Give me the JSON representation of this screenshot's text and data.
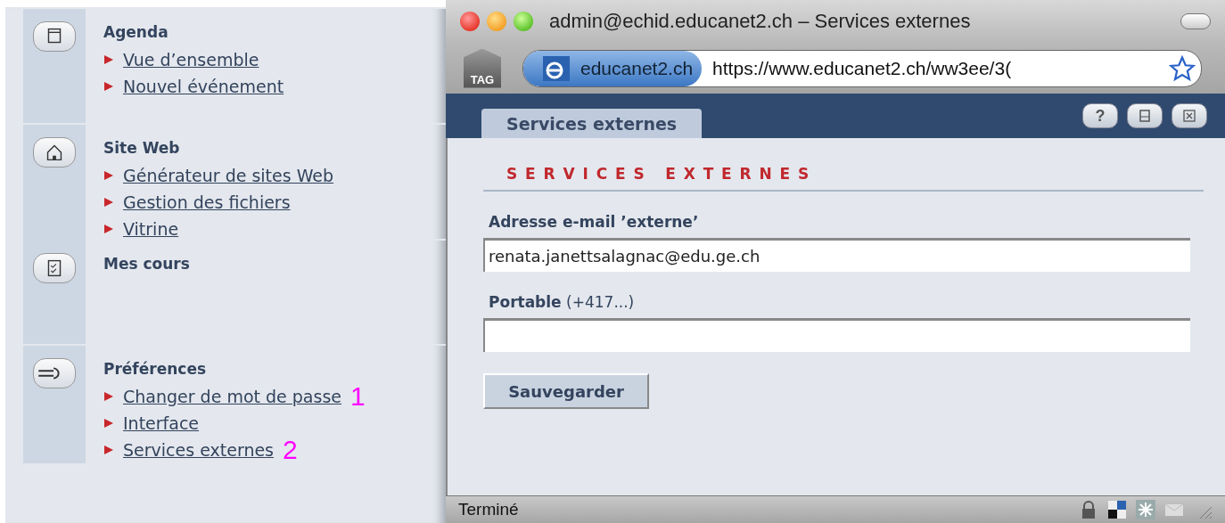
{
  "sidebar": {
    "sections": [
      {
        "kind": "agenda",
        "title": "Agenda",
        "items": [
          {
            "label": "Vue d’ensemble"
          },
          {
            "label": "Nouvel événement"
          }
        ]
      },
      {
        "kind": "site",
        "title": "Site Web",
        "items": [
          {
            "label": "Générateur de sites Web"
          },
          {
            "label": "Gestion des fichiers"
          },
          {
            "label": "Vitrine"
          }
        ]
      },
      {
        "kind": "courses",
        "title": "Mes cours"
      },
      {
        "kind": "prefs",
        "title": "Préférences",
        "items": [
          {
            "label": "Changer de mot de passe",
            "annotation": "1"
          },
          {
            "label": "Interface"
          },
          {
            "label": "Services externes",
            "annotation": "2"
          }
        ]
      }
    ]
  },
  "window": {
    "title": "admin@echid.educanet2.ch – Services externes",
    "site_label": "educanet2.ch",
    "tag_label": "TAG",
    "url": "https://www.educanet2.ch/ww3ee/3(",
    "tab": "Services externes",
    "tool_buttons": [
      {
        "kind": "help",
        "label": "?"
      },
      {
        "kind": "print"
      },
      {
        "kind": "close"
      }
    ],
    "heading": "SERVICES EXTERNES",
    "fields": [
      {
        "label": "Adresse e-mail ’externe’",
        "value": "renata.janettsalagnac@edu.ge.ch"
      },
      {
        "label": "**Portable** (+417...)"
      }
    ],
    "save_button": "Sauvegarder",
    "status": "Terminé"
  }
}
